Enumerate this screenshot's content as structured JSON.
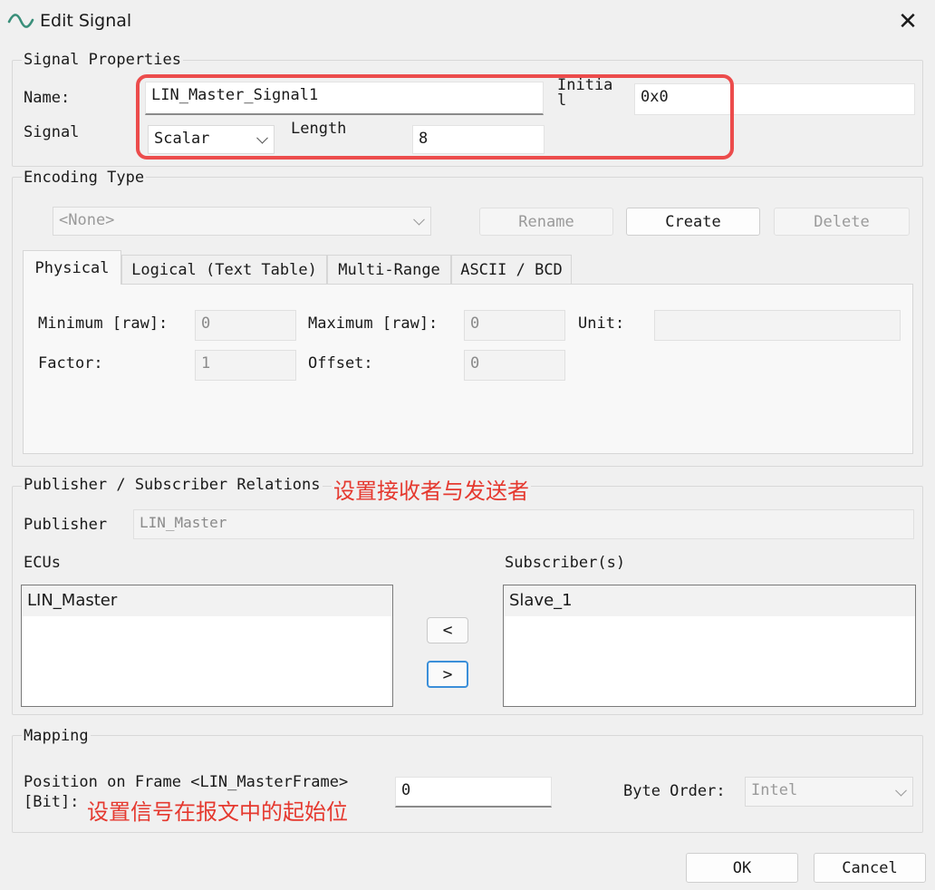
{
  "window": {
    "title": "Edit Signal",
    "close": "✕"
  },
  "signal_properties": {
    "group_label": "Signal Properties",
    "name_label": "Name:",
    "name_value": "LIN_Master_Signal1",
    "signal_label": "Signal",
    "signal_type": "Scalar",
    "length_label": "Length",
    "length_value": "8",
    "initial_label_line1": "Initia",
    "initial_label_line2": "l",
    "initial_value": "0x0"
  },
  "encoding": {
    "group_label": "Encoding Type",
    "combo_value": "<None>",
    "rename": "Rename",
    "create": "Create",
    "delete": "Delete",
    "tabs": [
      "Physical",
      "Logical (Text Table)",
      "Multi-Range",
      "ASCII / BCD"
    ],
    "minimum_label": "Minimum [raw]:",
    "minimum_value": "0",
    "maximum_label": "Maximum [raw]:",
    "maximum_value": "0",
    "unit_label": "Unit:",
    "factor_label": "Factor:",
    "factor_value": "1",
    "offset_label": "Offset:",
    "offset_value": "0"
  },
  "pubsub": {
    "group_label": "Publisher / Subscriber Relations",
    "annotation": "设置接收者与发送者",
    "publisher_label": "Publisher",
    "publisher_value": "LIN_Master",
    "ecus_label": "ECUs",
    "ecus_items": [
      "LIN_Master"
    ],
    "subscribers_label": "Subscriber(s)",
    "subscribers_items": [
      "Slave_1"
    ],
    "move_left": "<",
    "move_right": ">"
  },
  "mapping": {
    "group_label": "Mapping",
    "position_label_line1": "Position on Frame <LIN_MasterFrame>",
    "position_label_line2": "[Bit]:",
    "annotation": "设置信号在报文中的起始位",
    "position_value": "0",
    "byte_order_label": "Byte Order:",
    "byte_order_value": "Intel"
  },
  "footer": {
    "ok": "OK",
    "cancel": "Cancel"
  },
  "colors": {
    "annotation_red": "#e5392f",
    "highlight_box": "#ec4c4c",
    "focus_blue": "#3b8fd9"
  }
}
